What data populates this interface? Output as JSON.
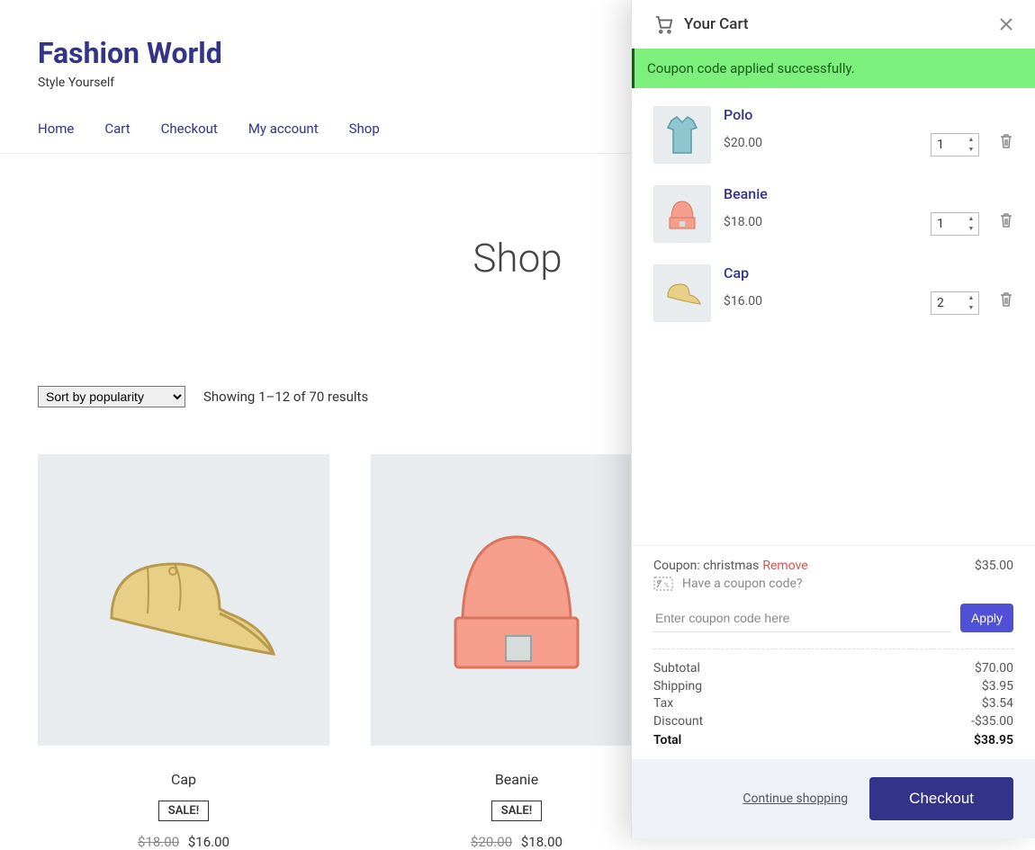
{
  "site": {
    "title": "Fashion World",
    "tagline": "Style Yourself"
  },
  "nav": [
    "Home",
    "Cart",
    "Checkout",
    "My account",
    "Shop"
  ],
  "page_heading": "Shop",
  "sort_label": "Sort by popularity",
  "result_count": "Showing 1–12 of 70 results",
  "products": [
    {
      "name": "Cap",
      "sale": "SALE!",
      "old_price": "$18.00",
      "price": "$16.00"
    },
    {
      "name": "Beanie",
      "sale": "SALE!",
      "old_price": "$20.00",
      "price": "$18.00"
    }
  ],
  "cart": {
    "title": "Your Cart",
    "success_message": "Coupon code applied successfully.",
    "items": [
      {
        "name": "Polo",
        "price": "$20.00",
        "qty": "1"
      },
      {
        "name": "Beanie",
        "price": "$18.00",
        "qty": "1"
      },
      {
        "name": "Cap",
        "price": "$16.00",
        "qty": "2"
      }
    ],
    "coupon_label": "Coupon: christmas",
    "coupon_remove": "Remove",
    "coupon_amount": "$35.00",
    "coupon_prompt": "Have a coupon code?",
    "coupon_placeholder": "Enter coupon code here",
    "apply_label": "Apply",
    "totals": {
      "subtotal_label": "Subtotal",
      "subtotal": "$70.00",
      "shipping_label": "Shipping",
      "shipping": "$3.95",
      "tax_label": "Tax",
      "tax": "$3.54",
      "discount_label": "Discount",
      "discount": "-$35.00",
      "total_label": "Total",
      "total": "$38.95"
    },
    "continue": "Continue shopping",
    "checkout": "Checkout"
  }
}
